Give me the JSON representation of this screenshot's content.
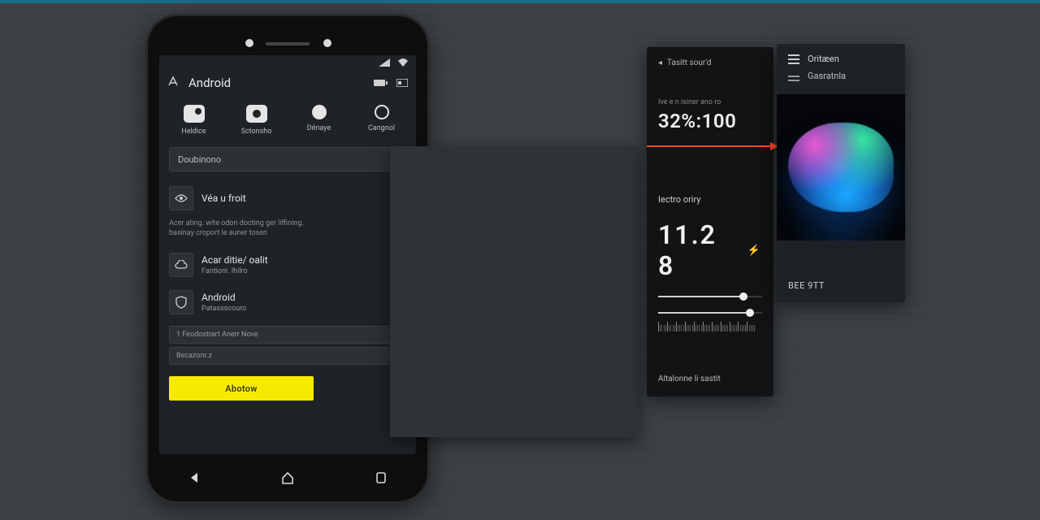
{
  "phone": {
    "appbar": {
      "title": "Android"
    },
    "iconRow": [
      {
        "label": "Heldice"
      },
      {
        "label": "Sctonsho"
      },
      {
        "label": "Dénaye"
      },
      {
        "label": "Cangnol"
      }
    ],
    "searchPlaceholder": "Doubinono",
    "rowVideo": {
      "title": "Véa u froit"
    },
    "desc": "Acer ating. wite odon docting ger liffining.\nbasinay croport le auner tosen",
    "rowAutofill": {
      "title": "Acar ditie/ oalit",
      "subtitle": "Fantioni. Ihilro"
    },
    "rowAndroid": {
      "title": "Android",
      "subtitle": "Patassscouro"
    },
    "extraField1": "1 Feodostrart Anerr Nove",
    "extraField2": "Becazonr.z",
    "primaryButton": "Abotow"
  },
  "stats": {
    "crumb": "Tasitt sour'd",
    "smallLabel": "Ive e n isiner ano ro",
    "metric1": "32%:100",
    "sectionLabel": "Iectro oriry",
    "metric2": "11.2 8",
    "footer": "Altalonne li sastit"
  },
  "art": {
    "header": "Oritæen",
    "subheader": "Gasratnla",
    "caption": "BEE 9TT"
  }
}
